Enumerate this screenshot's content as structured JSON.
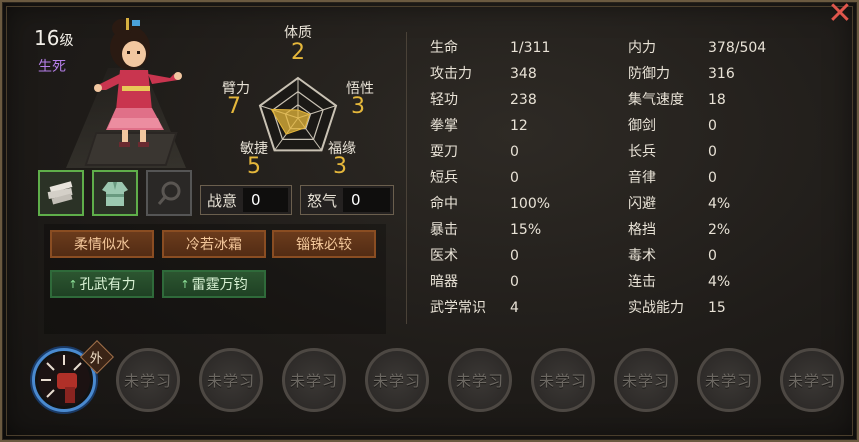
{
  "character": {
    "level_number": "16",
    "level_unit": "级",
    "realm": "生死"
  },
  "combat": {
    "zhanyi_label": "战意",
    "zhanyi_value": "0",
    "nuqi_label": "怒气",
    "nuqi_value": "0"
  },
  "traits": [
    {
      "label": "柔情似水",
      "color": "orange"
    },
    {
      "label": "冷若冰霜",
      "color": "orange"
    },
    {
      "label": "锱铢必较",
      "color": "orange"
    },
    {
      "label": "孔武有力",
      "color": "green",
      "arrow": "↑"
    },
    {
      "label": "雷霆万钧",
      "color": "green",
      "arrow": "↑"
    }
  ],
  "radar": {
    "tizhi_label": "体质",
    "tizhi_value": "2",
    "wuxing_label": "悟性",
    "wuxing_value": "3",
    "fuyuan_label": "福缘",
    "fuyuan_value": "3",
    "minjie_label": "敏捷",
    "minjie_value": "5",
    "bili_label": "臂力",
    "bili_value": "7",
    "max": 10
  },
  "stats": {
    "left": [
      {
        "k": "生命",
        "v": "1/311"
      },
      {
        "k": "攻击力",
        "v": "348"
      },
      {
        "k": "轻功",
        "v": "238"
      },
      {
        "k": "拳掌",
        "v": "12"
      },
      {
        "k": "耍刀",
        "v": "0"
      },
      {
        "k": "短兵",
        "v": "0"
      },
      {
        "k": "命中",
        "v": "100%"
      },
      {
        "k": "暴击",
        "v": "15%"
      },
      {
        "k": "医术",
        "v": "0"
      },
      {
        "k": "暗器",
        "v": "0"
      },
      {
        "k": "武学常识",
        "v": "4"
      }
    ],
    "right": [
      {
        "k": "内力",
        "v": "378/504"
      },
      {
        "k": "防御力",
        "v": "316"
      },
      {
        "k": "集气速度",
        "v": "18"
      },
      {
        "k": "御剑",
        "v": "0"
      },
      {
        "k": "长兵",
        "v": "0"
      },
      {
        "k": "音律",
        "v": "0"
      },
      {
        "k": "闪避",
        "v": "4%"
      },
      {
        "k": "格挡",
        "v": "2%"
      },
      {
        "k": "毒术",
        "v": "0"
      },
      {
        "k": "连击",
        "v": "4%"
      },
      {
        "k": "实战能力",
        "v": "15"
      }
    ]
  },
  "skills": {
    "active_tag": "外",
    "empty_label": "未学习"
  },
  "icons": {
    "close": "close-icon",
    "equip1": "bandage-icon",
    "equip2": "robe-icon",
    "equip3": "empty-slot-icon",
    "skill1": "fist-icon"
  },
  "colors": {
    "accent_gold": "#e5b73b",
    "realm_purple": "#b57fe8",
    "equip_green": "#5fae4a",
    "trait_orange": "#8a4d22",
    "trait_green": "#2f6a3a",
    "close_red": "#e0564c"
  }
}
